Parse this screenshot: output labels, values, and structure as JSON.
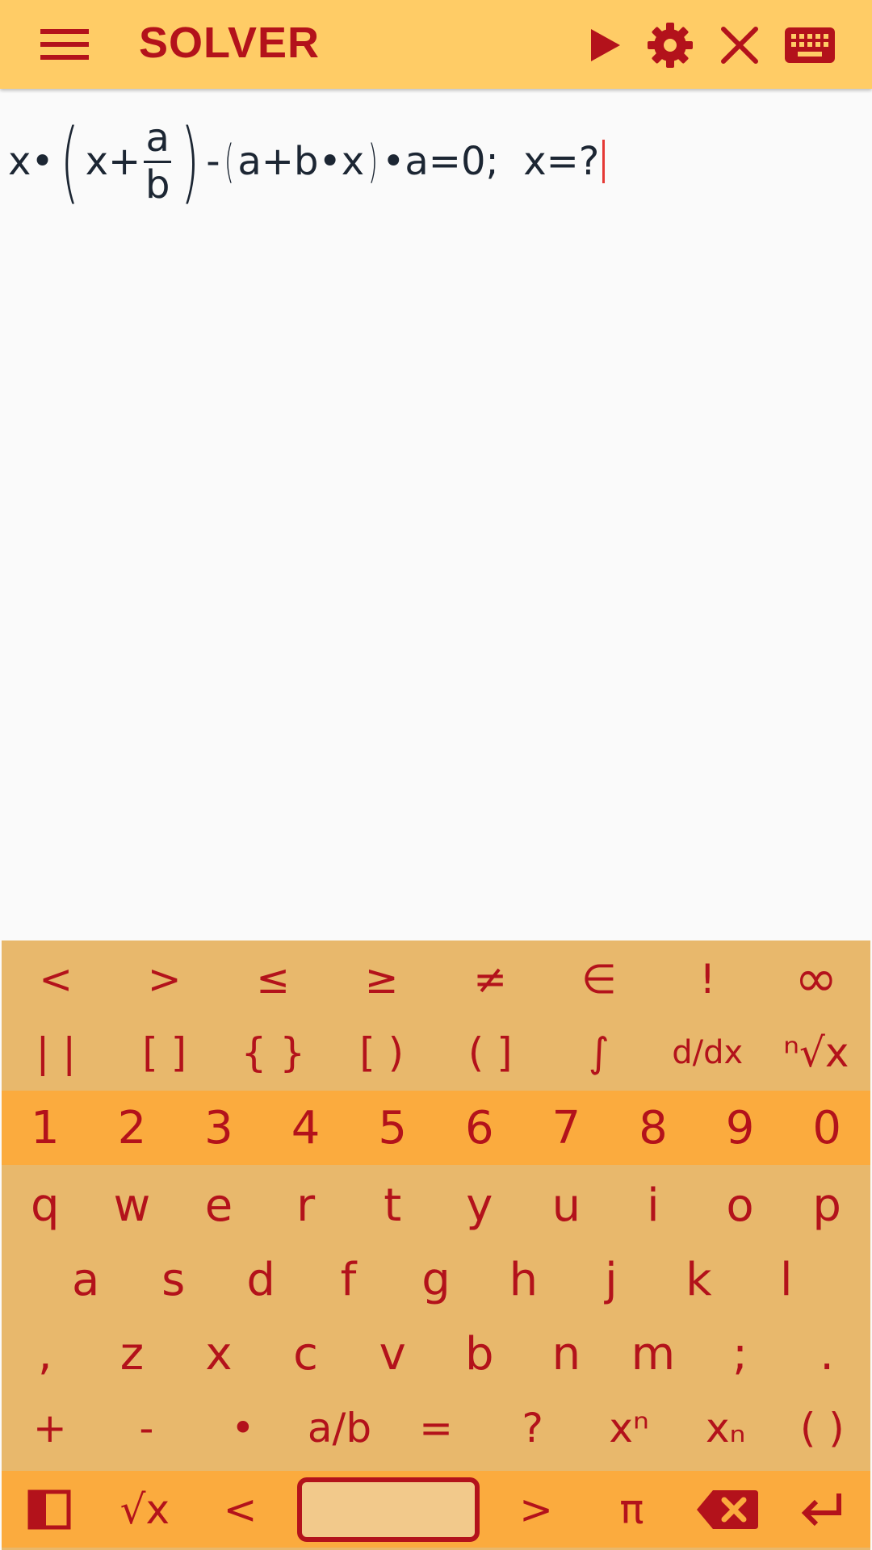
{
  "app": {
    "title": "SOLVER"
  },
  "toolbar": {
    "icons": [
      "menu-icon",
      "play-icon",
      "gear-icon",
      "close-icon",
      "keyboard-icon"
    ]
  },
  "expression": {
    "prefix": "x•",
    "inner_left": "x+",
    "frac_num": "a",
    "frac_den": "b",
    "minus": "-",
    "group2": "a+b•x",
    "suffix": "•a=0;  x=?"
  },
  "keyboard": {
    "row_sym1": [
      "<",
      ">",
      "≤",
      "≥",
      "≠",
      "∈",
      "!",
      "∞"
    ],
    "row_sym2": [
      "| |",
      "[ ]",
      "{ }",
      "[ )",
      "( ]",
      "∫",
      "d/dx",
      "ⁿ√x"
    ],
    "row_num": [
      "1",
      "2",
      "3",
      "4",
      "5",
      "6",
      "7",
      "8",
      "9",
      "0"
    ],
    "row_q": [
      "q",
      "w",
      "e",
      "r",
      "t",
      "y",
      "u",
      "i",
      "o",
      "p"
    ],
    "row_a": [
      "a",
      "s",
      "d",
      "f",
      "g",
      "h",
      "j",
      "k",
      "l"
    ],
    "row_z": [
      ",",
      "z",
      "x",
      "c",
      "v",
      "b",
      "n",
      "m",
      ";",
      "."
    ],
    "row_op": [
      "+",
      "-",
      "•",
      "a/b",
      "=",
      "?",
      "xⁿ",
      "xₙ",
      "( )"
    ],
    "row_bottom": [
      "panel-icon",
      "√x",
      "<",
      "space",
      ">",
      "π",
      "backspace-icon",
      "enter-icon"
    ]
  },
  "colors": {
    "accent": "#b3121b",
    "topbar": "#ffcc66",
    "keyboard": "#e8b86c",
    "highlight_row": "#fbab3e"
  }
}
